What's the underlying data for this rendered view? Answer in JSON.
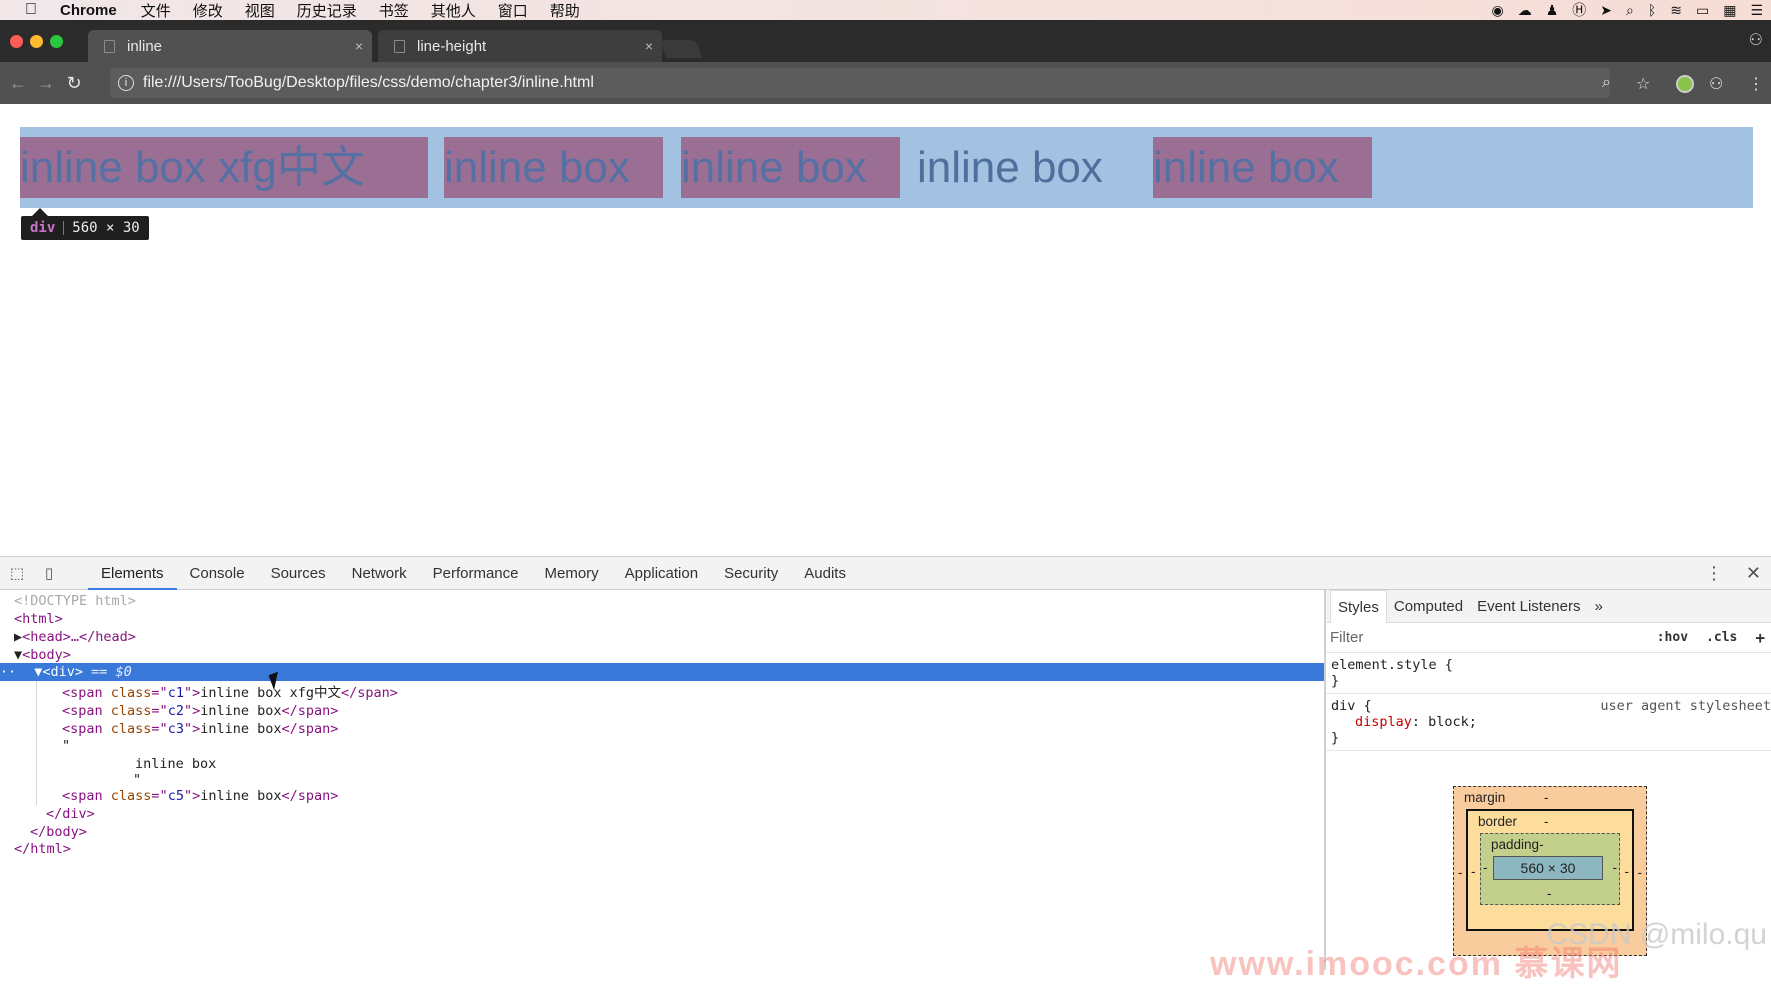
{
  "menubar": {
    "apple": "",
    "items": [
      "Chrome",
      "文件",
      "修改",
      "视图",
      "历史记录",
      "书签",
      "其他人",
      "窗口",
      "帮助"
    ]
  },
  "tabs": [
    {
      "title": "inline",
      "close": "×"
    },
    {
      "title": "line-height",
      "close": "×"
    }
  ],
  "toolbar": {
    "url": "file:///Users/TooBug/Desktop/files/css/demo/chapter3/inline.html",
    "info_icon": "i",
    "back_icon": "←",
    "forward_icon": "→",
    "reload_icon": "↻",
    "zoom_icon": "⌕",
    "star_icon": "☆"
  },
  "page": {
    "spans": [
      "inline box xfg中文",
      "inline box",
      "inline box",
      "inline box",
      "inline box"
    ],
    "tooltip": {
      "tag": "div",
      "size": "560 × 30"
    }
  },
  "devtools": {
    "tabs": [
      "Elements",
      "Console",
      "Sources",
      "Network",
      "Performance",
      "Memory",
      "Application",
      "Security",
      "Audits"
    ],
    "active_tab": "Elements",
    "dom": {
      "doctype": "<!DOCTYPE html>",
      "html_open": "<html>",
      "head": "<head>…</head>",
      "body_open": "<body>",
      "div_open": "<div>",
      "div_marker": " == $0",
      "span1_class": "c1",
      "span1_text": "inline box xfg中文",
      "span2_class": "c2",
      "span2_text": "inline box",
      "span3_class": "c3",
      "span3_text": "inline box",
      "quote_open": "\"",
      "text_node": "inline box",
      "quote_close": "\"",
      "span5_class": "c5",
      "span5_text": "inline box",
      "div_close": "</div>",
      "body_close": "</body>",
      "html_close": "</html>"
    },
    "side": {
      "tabs": [
        "Styles",
        "Computed",
        "Event Listeners"
      ],
      "more": "»",
      "filter_placeholder": "Filter",
      "hov": ":hov",
      "cls": ".cls",
      "add": "+",
      "element_style": "element.style {",
      "close_brace": "}",
      "div_selector": "div {",
      "ua_label": "user agent stylesheet",
      "decl_prop": "display",
      "decl_val": "block;",
      "box": {
        "margin": "margin",
        "margin_val": "-",
        "border": "border",
        "border_val": "-",
        "padding": "padding-",
        "padding_bottom": "-",
        "content": "560 × 30",
        "side_dash": "-"
      }
    },
    "watermark": "CSDN @milo.qu",
    "watermark2": "www.imooc.com 慕课网"
  },
  "colors": {
    "selection": "#3879d9",
    "div_bg": "#a3c2e2",
    "span_bg": "#9b6f94"
  }
}
